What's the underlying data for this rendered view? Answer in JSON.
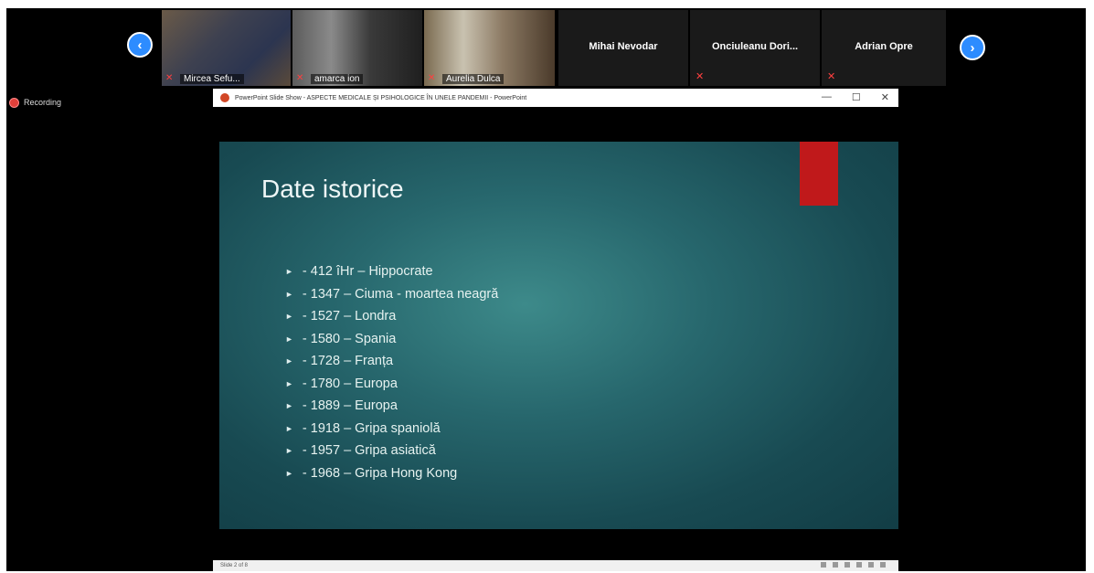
{
  "gallery": {
    "video_tiles": [
      {
        "name": "Mircea Sefu..."
      },
      {
        "name": "amarca ion"
      },
      {
        "name": "Aurelia Dulca"
      }
    ],
    "name_tiles": [
      {
        "name": "Mihai Nevodar"
      },
      {
        "name": "Onciuleanu Dori..."
      },
      {
        "name": "Adrian Opre"
      }
    ]
  },
  "recording": {
    "label": "Recording"
  },
  "ppt": {
    "window_title": "PowerPoint Slide Show - ASPECTE MEDICALE ȘI PSIHOLOGICE ÎN UNELE PANDEMII - PowerPoint",
    "controls": {
      "minimize": "—",
      "restore": "☐",
      "close": "✕"
    },
    "status_text": "Slide 2 of 8"
  },
  "slide": {
    "title": "Date istorice",
    "accent_color": "#c0191b",
    "bullets": [
      "- 412 îHr – Hippocrate",
      "- 1347 – Ciuma - moartea neagră",
      "- 1527 – Londra",
      "- 1580 – Spania",
      "- 1728 – Franța",
      "- 1780 – Europa",
      "- 1889 – Europa",
      "- 1918 – Gripa spaniolă",
      "- 1957 – Gripa asiatică",
      "- 1968 – Gripa Hong Kong"
    ]
  }
}
